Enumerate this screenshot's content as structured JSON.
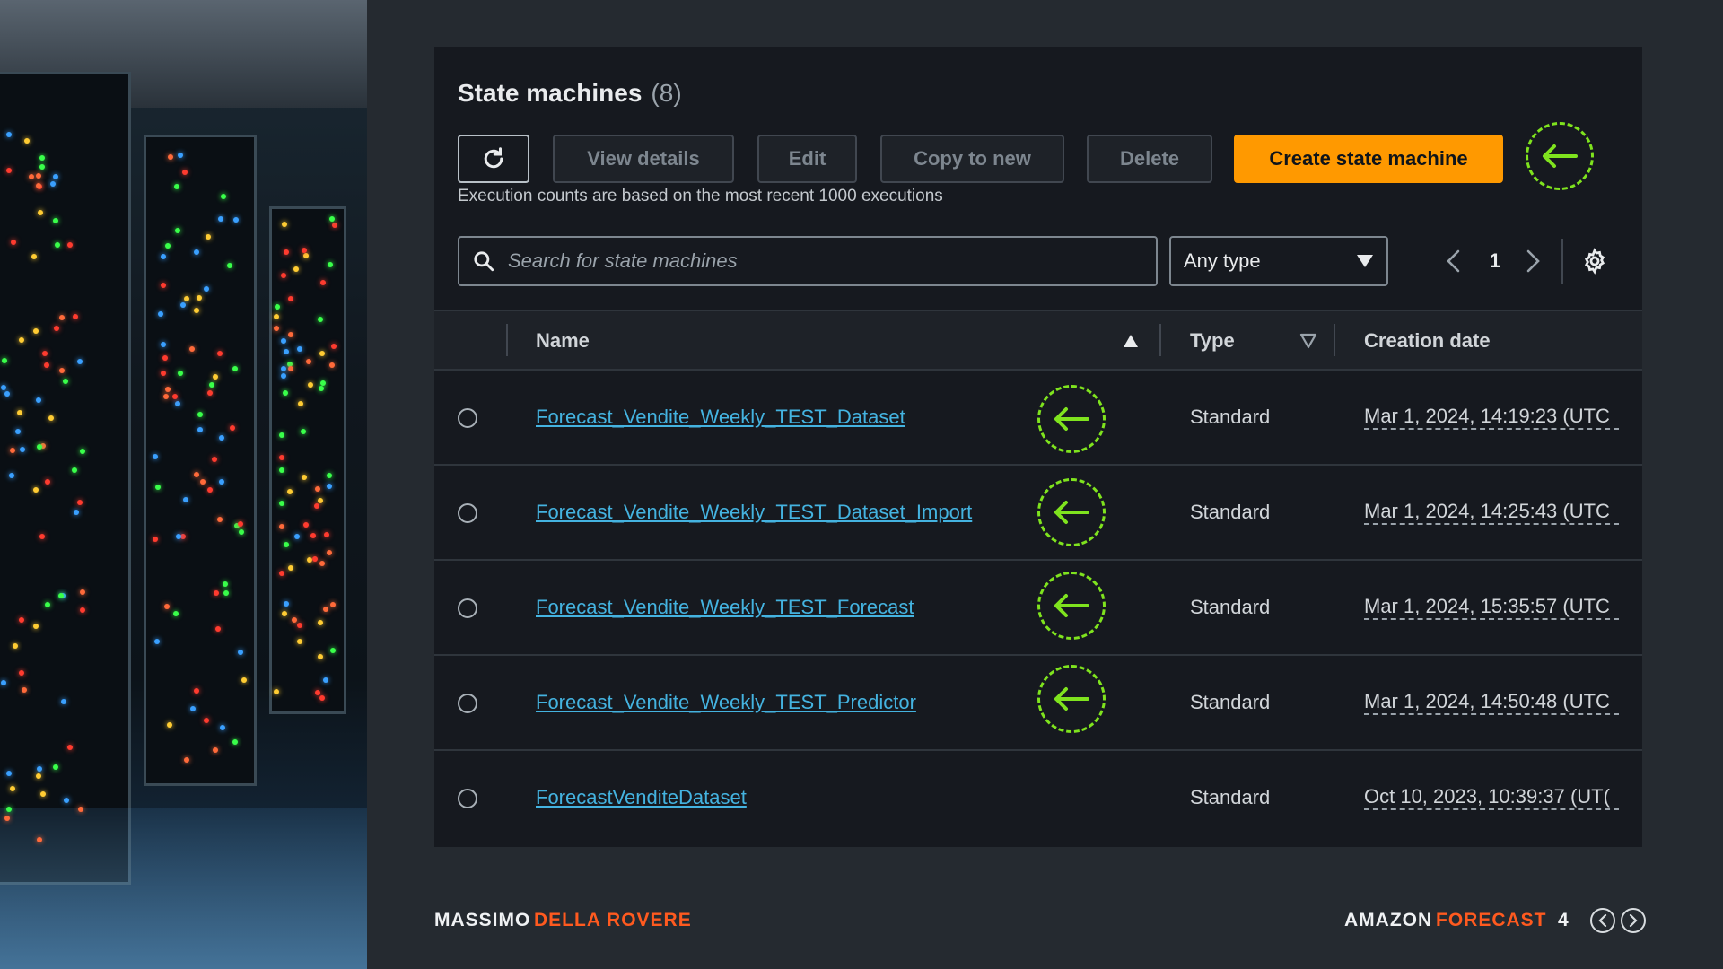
{
  "header": {
    "title": "State machines",
    "count": "(8)"
  },
  "toolbar": {
    "view_details": "View details",
    "edit": "Edit",
    "copy_to_new": "Copy to new",
    "delete": "Delete",
    "create": "Create state machine",
    "note": "Execution counts are based on the most recent 1000 executions"
  },
  "filters": {
    "search_placeholder": "Search for state machines",
    "type_selected": "Any type",
    "page": "1"
  },
  "table": {
    "columns": {
      "name": "Name",
      "type": "Type",
      "creation_date": "Creation date"
    },
    "rows": [
      {
        "name": "Forecast_Vendite_Weekly_TEST_Dataset",
        "type": "Standard",
        "date": "Mar 1, 2024, 14:19:23 (UTC",
        "highlighted": true
      },
      {
        "name": "Forecast_Vendite_Weekly_TEST_Dataset_Import",
        "type": "Standard",
        "date": "Mar 1, 2024, 14:25:43 (UTC",
        "highlighted": true
      },
      {
        "name": "Forecast_Vendite_Weekly_TEST_Forecast",
        "type": "Standard",
        "date": "Mar 1, 2024, 15:35:57 (UTC",
        "highlighted": true
      },
      {
        "name": "Forecast_Vendite_Weekly_TEST_Predictor",
        "type": "Standard",
        "date": "Mar 1, 2024, 14:50:48 (UTC",
        "highlighted": true
      },
      {
        "name": "ForecastVenditeDataset",
        "type": "Standard",
        "date": "Oct 10, 2023, 10:39:37 (UT(",
        "highlighted": false
      }
    ]
  },
  "footer": {
    "author_first": "MASSIMO",
    "author_last": "DELLA ROVERE",
    "brand_first": "AMAZON",
    "brand_second": "FORECAST",
    "slide_number": "4"
  },
  "icons": {
    "refresh": "refresh-icon",
    "search": "search-icon",
    "dropdown": "caret-down-icon",
    "prev": "chevron-left-icon",
    "next": "chevron-right-icon",
    "settings": "gear-icon",
    "callout": "arrow-left-icon",
    "sort_asc": "sort-ascending-icon",
    "sort": "sort-icon"
  },
  "colors": {
    "accent_orange": "#ff9900",
    "link_blue": "#44b3e0",
    "callout_green": "#7fe31e",
    "footer_orange": "#ff5a1f",
    "panel_bg": "#16191f",
    "slide_bg": "#252a30"
  }
}
